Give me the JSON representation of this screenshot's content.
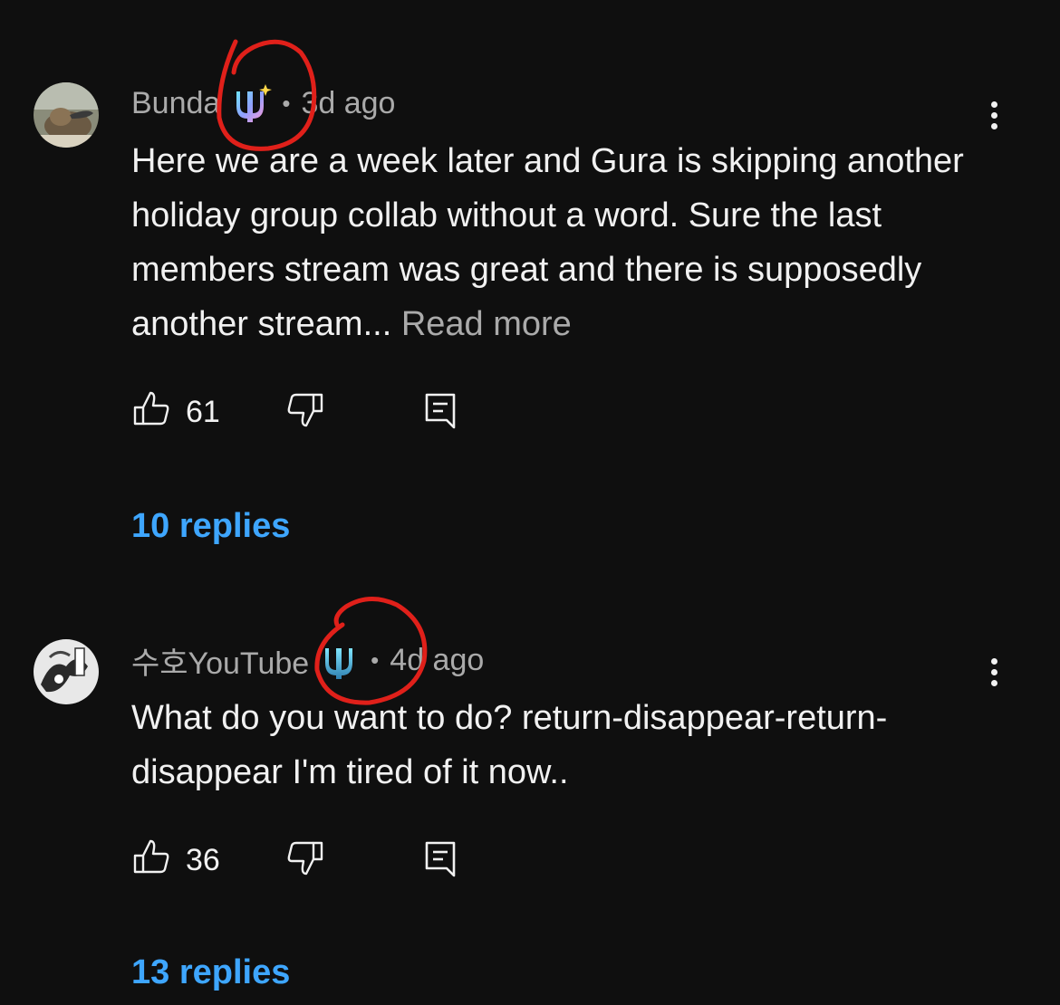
{
  "comments": [
    {
      "author": "Bunda",
      "badge_icon": "trident-member-badge-sparkle",
      "time": "3d ago",
      "separator": "•",
      "text": "Here we are a week later and Gura is skipping another holiday group collab without a word. Sure the last members stream was great and there is supposedly another stream...",
      "read_more": "Read more",
      "likes": "61",
      "replies": "10 replies"
    },
    {
      "author": "수호YouTube",
      "badge_icon": "trident-member-badge",
      "time": "4d ago",
      "separator": "•",
      "text": "What do you want to do? return-disappear-return-disappear I'm tired of it now..",
      "read_more": "",
      "likes": "36",
      "replies": "13 replies"
    }
  ],
  "colors": {
    "background": "#0f0f0f",
    "text": "#f1f1f1",
    "muted": "#aaaaaa",
    "link": "#3ea6ff",
    "annotation": "#e0201a"
  },
  "icons": [
    "thumbs-up-icon",
    "thumbs-down-icon",
    "reply-icon",
    "more-vert-icon"
  ]
}
